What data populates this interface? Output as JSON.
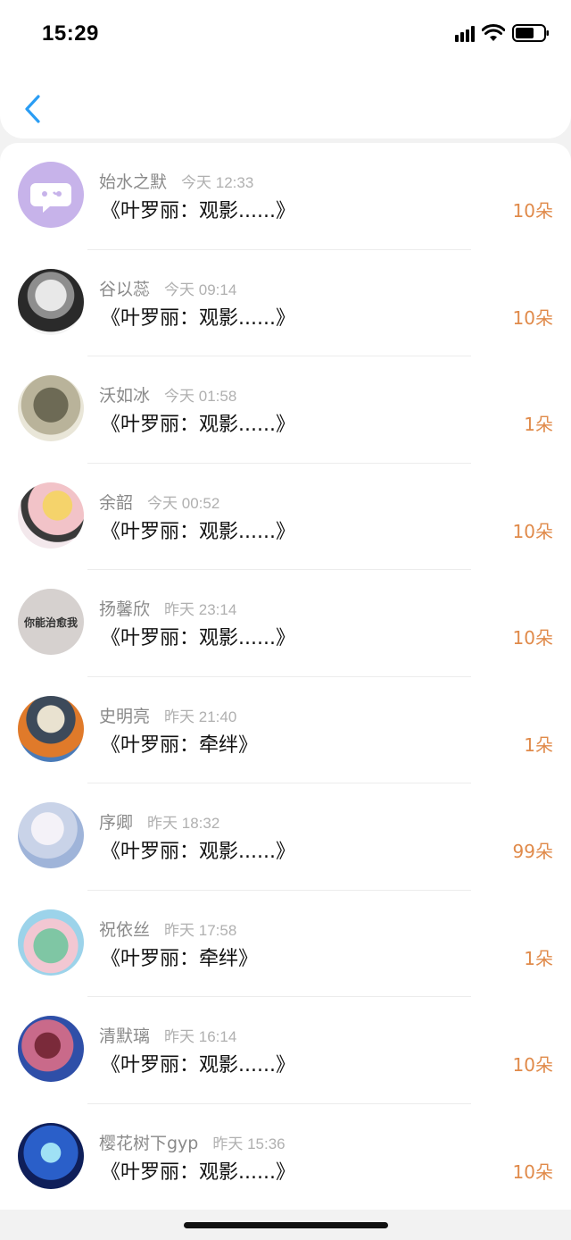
{
  "status_bar": {
    "time": "15:29"
  },
  "colors": {
    "accent": "#2a9df4",
    "count": "#e08a4a",
    "name": "#8a8a8a",
    "time": "#b0b0b0"
  },
  "header": {
    "back_icon": "chevron-left-icon"
  },
  "gifts": [
    {
      "name": "始水之默",
      "time": "今天 12:33",
      "title": "《叶罗丽：观影......》",
      "count": "10朵"
    },
    {
      "name": "谷以蕊",
      "time": "今天 09:14",
      "title": "《叶罗丽：观影......》",
      "count": "10朵"
    },
    {
      "name": "沃如冰",
      "time": "今天 01:58",
      "title": "《叶罗丽：观影......》",
      "count": "1朵"
    },
    {
      "name": "余韶",
      "time": "今天 00:52",
      "title": "《叶罗丽：观影......》",
      "count": "10朵"
    },
    {
      "name": "扬馨欣",
      "time": "昨天 23:14",
      "title": "《叶罗丽：观影......》",
      "count": "10朵",
      "avatar_text": "你能治愈我"
    },
    {
      "name": "史明亮",
      "time": "昨天 21:40",
      "title": "《叶罗丽：牵绊》",
      "count": "1朵"
    },
    {
      "name": "序卿",
      "time": "昨天 18:32",
      "title": "《叶罗丽：观影......》",
      "count": "99朵"
    },
    {
      "name": "祝依丝",
      "time": "昨天 17:58",
      "title": "《叶罗丽：牵绊》",
      "count": "1朵"
    },
    {
      "name": "清默璃",
      "time": "昨天 16:14",
      "title": "《叶罗丽：观影......》",
      "count": "10朵"
    },
    {
      "name": "樱花树下gyp",
      "time": "昨天 15:36",
      "title": "《叶罗丽：观影......》",
      "count": "10朵"
    }
  ]
}
